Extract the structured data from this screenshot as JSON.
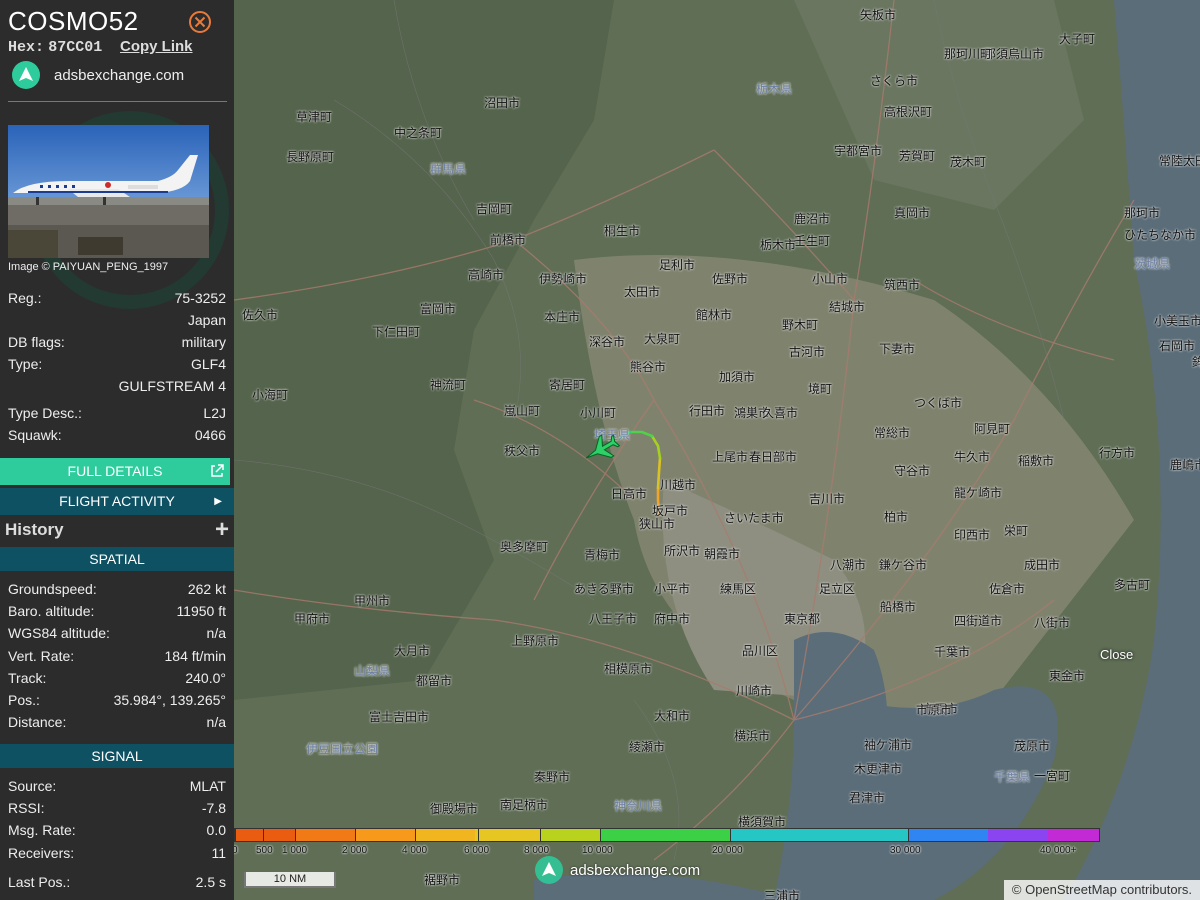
{
  "aircraft": {
    "callsign": "COSMO52",
    "hex_label": "Hex:",
    "hex": "87CC01",
    "copy_link": "Copy Link",
    "brand": "adsbexchange.com",
    "image_credit": "Image © PAIYUAN_PENG_1997"
  },
  "details": [
    {
      "key": "Reg.:",
      "value": "75-3252"
    },
    {
      "key": "",
      "value": "Japan"
    },
    {
      "key": "DB flags:",
      "value": "military"
    },
    {
      "key": "Type:",
      "value": "GLF4"
    },
    {
      "key": "",
      "value": "GULFSTREAM 4"
    },
    {
      "key": "Type Desc.:",
      "value": "L2J"
    },
    {
      "key": "Squawk:",
      "value": "0466"
    }
  ],
  "buttons": {
    "full_details": "FULL DETAILS",
    "flight_activity": "FLIGHT ACTIVITY",
    "history": "History",
    "history_plus": "+"
  },
  "sections": {
    "spatial": "SPATIAL",
    "signal": "SIGNAL"
  },
  "spatial": [
    {
      "key": "Groundspeed:",
      "value": "262 kt"
    },
    {
      "key": "Baro. altitude:",
      "value": "11950 ft"
    },
    {
      "key": "WGS84 altitude:",
      "value": "n/a"
    },
    {
      "key": "Vert. Rate:",
      "value": "184 ft/min"
    },
    {
      "key": "Track:",
      "value": "240.0°"
    },
    {
      "key": "Pos.:",
      "value": "35.984°, 139.265°"
    },
    {
      "key": "Distance:",
      "value": "n/a"
    }
  ],
  "signal": [
    {
      "key": "Source:",
      "value": "MLAT"
    },
    {
      "key": "RSSI:",
      "value": "-7.8"
    },
    {
      "key": "Msg. Rate:",
      "value": "0.0"
    },
    {
      "key": "Receivers:",
      "value": "11"
    },
    {
      "key": "Last Pos.:",
      "value": "2.5 s"
    }
  ],
  "map": {
    "close": "Close",
    "brand": "adsbexchange.com",
    "scale": "10 NM",
    "attribution": "© OpenStreetMap contributors.",
    "legend_labels": [
      "0",
      "500",
      "1 000",
      "2 000",
      "4 000",
      "6 000",
      "8 000",
      "10 000",
      "20 000",
      "30 000",
      "40 000+"
    ],
    "cities": [
      "矢板市",
      "さくら市",
      "那須烏山市",
      "那珂川町",
      "大子町",
      "沼田市",
      "草津町",
      "中之条町",
      "長野原町",
      "宇都宮市",
      "高根沢町",
      "芳賀町",
      "茂木町",
      "常陸太田市",
      "群馬県",
      "栃木県",
      "吉岡町",
      "鹿沼市",
      "壬生町",
      "真岡市",
      "前橋市",
      "桐生市",
      "栃木市",
      "那珂市",
      "ひたちなか市",
      "高崎市",
      "伊勢崎市",
      "足利市",
      "佐野市",
      "小山市",
      "筑西市",
      "茨城県",
      "佐久市",
      "富岡市",
      "太田市",
      "本庄市",
      "館林市",
      "野木町",
      "結城市",
      "小美玉市",
      "下仁田町",
      "深谷市",
      "大泉町",
      "古河市",
      "下妻市",
      "石岡市",
      "鉾田市",
      "小海町",
      "神流町",
      "寄居町",
      "熊谷市",
      "加須市",
      "境町",
      "つくば市",
      "嵐山町",
      "小川町",
      "行田市",
      "鴻巣市",
      "久喜市",
      "常総市",
      "阿見町",
      "秩父市",
      "埼玉県",
      "上尾市",
      "春日部市",
      "守谷市",
      "牛久市",
      "稲敷市",
      "行方市",
      "鹿嶋市",
      "日高市",
      "坂戸市",
      "川越市",
      "吉川市",
      "龍ケ崎市",
      "狭山市",
      "さいたま市",
      "柏市",
      "印西市",
      "栄町",
      "奥多摩町",
      "青梅市",
      "所沢市",
      "朝霞市",
      "八潮市",
      "鎌ケ谷市",
      "成田市",
      "多古町",
      "甲州市",
      "あきる野市",
      "小平市",
      "練馬区",
      "足立区",
      "佐倉市",
      "甲府市",
      "八王子市",
      "府中市",
      "東京都",
      "船橋市",
      "四街道市",
      "八街市",
      "大月市",
      "上野原市",
      "品川区",
      "千葉市",
      "東金市",
      "山梨県",
      "相模原市",
      "市原市",
      "都留市",
      "川崎市",
      "富士吉田市",
      "大和市",
      "横浜市",
      "袖ケ浦市",
      "茂原市",
      "綾瀬市",
      "伊豆国立公園",
      "木更津市",
      "一宮町",
      "秦野市",
      "君津市",
      "千葉県",
      "御殿場市",
      "南足柄市",
      "神奈川県",
      "横須賀市",
      "裾野市",
      "三浦市",
      "市原市"
    ]
  },
  "colors": {
    "accent_green": "#2ecc9c",
    "section_teal": "#0d5163",
    "sidebar_bg": "#2c2c2c",
    "map_bg": "#5d6b52"
  }
}
